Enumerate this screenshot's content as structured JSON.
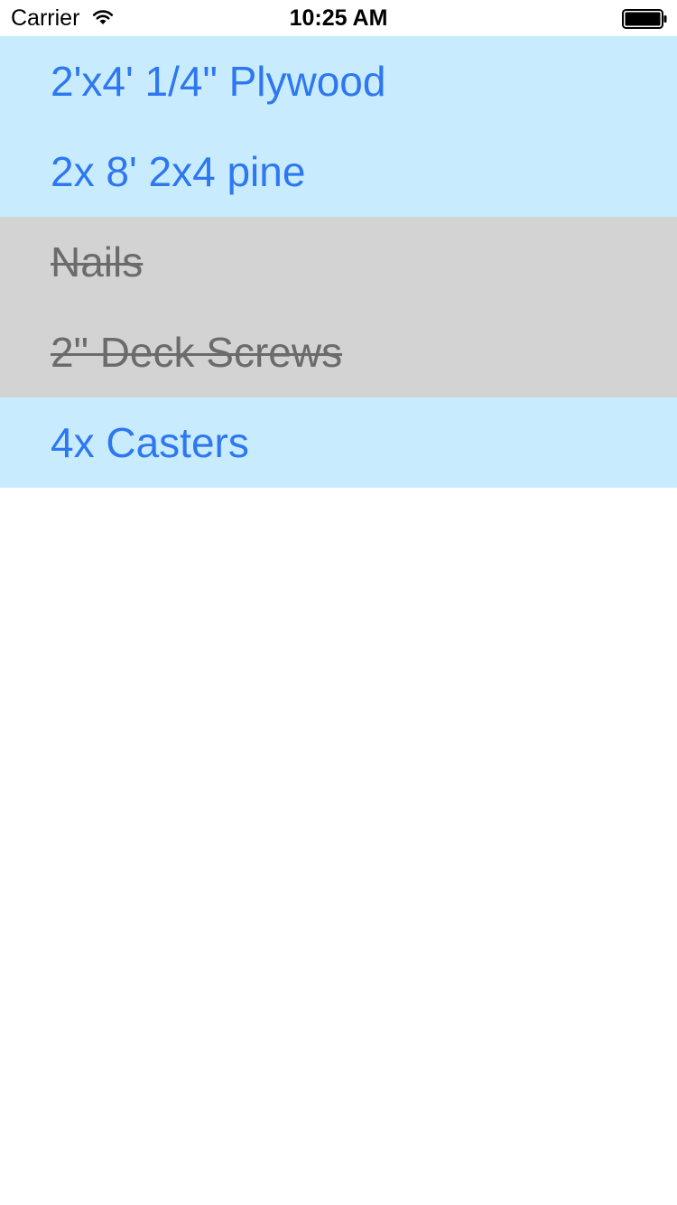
{
  "status_bar": {
    "carrier": "Carrier",
    "time": "10:25 AM",
    "wifi_icon": "wifi-icon",
    "battery_icon": "battery-icon"
  },
  "colors": {
    "active_row_bg": "#c8ecfd",
    "done_row_bg": "#d3d3d3",
    "active_text": "#2e77f0",
    "done_text": "#6b6b6b"
  },
  "items": [
    {
      "label": "2'x4' 1/4\" Plywood",
      "completed": false
    },
    {
      "label": "2x 8' 2x4 pine",
      "completed": false
    },
    {
      "label": "Nails",
      "completed": true
    },
    {
      "label": "2\" Deck Screws",
      "completed": true
    },
    {
      "label": "4x Casters",
      "completed": false
    }
  ]
}
